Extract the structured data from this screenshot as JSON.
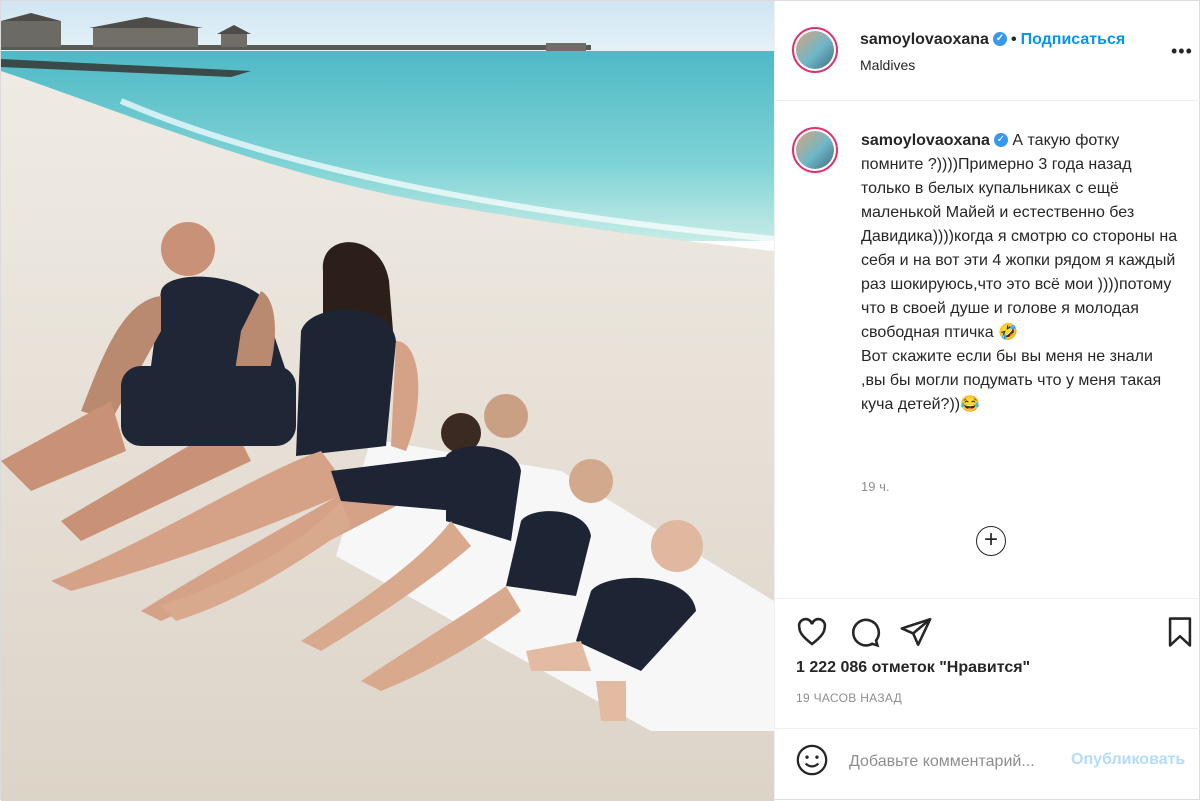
{
  "post": {
    "photo_alt": "",
    "header": {
      "username": "samoylovaoxana",
      "follow_label": "Подписаться",
      "location": "Maldives",
      "more_label": "•••"
    },
    "caption": {
      "username": "samoylovaoxana",
      "text": "А такую фотку помните ?))))Примерно 3 года назад только в белых купальниках с ещё маленькой Майей и естественно без Давидика))))когда я смотрю со стороны на себя и на вот эти 4 жопки рядом я каждый раз шокируюсь,что это всё мои ))))потому что в своей душе и голове я молодая свободная птичка 🤣\nВот скажите если бы вы меня не знали ,вы бы могли подумать что у меня такая куча детей?))😂",
      "time": "19 ч."
    },
    "load_more_label": "+",
    "likes": "1 222 086 отметок \"Нравится\"",
    "posted": "19 ЧАСОВ НАЗАД",
    "comment": {
      "placeholder": "Добавьте комментарий...",
      "publish_label": "Опубликовать"
    },
    "icons": [
      "heart-icon",
      "comment-icon",
      "share-icon",
      "bookmark-icon",
      "emoji-icon",
      "verified-icon",
      "plus-circle-icon"
    ],
    "colors": {
      "accent": "#0095f6",
      "publish_disabled": "#b3dbff",
      "verified": "#3897f0",
      "muted": "#8e8e8e",
      "text": "#262626"
    }
  }
}
